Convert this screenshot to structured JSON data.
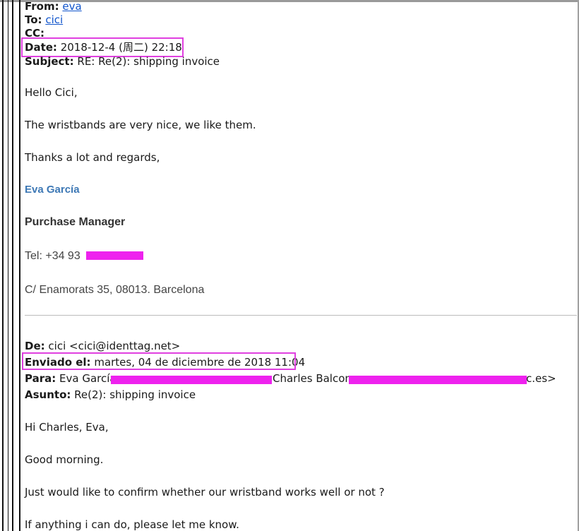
{
  "reply": {
    "from_label": "From:",
    "from_value": "eva",
    "to_label": "To:",
    "to_value": "cici",
    "cc_label": "CC:",
    "date_label": "Date:",
    "date_value": "2018-12-4 (周二) 22:18",
    "subject_label": "Subject:",
    "subject_value": "RE: Re(2): shipping invoice",
    "body": [
      "Hello Cici,",
      "The wristbands are very nice, we like them.",
      "Thanks a lot and regards,"
    ],
    "signature": {
      "name": "Eva García",
      "title": "Purchase Manager",
      "tel": "Tel: +34 93",
      "address": "C/ Enamorats 35, 08013. Barcelona"
    }
  },
  "original": {
    "de_label": "De:",
    "de_value": "cici <cici@identtag.net>",
    "enviado_label": "Enviado el:",
    "enviado_value": "martes, 04 de diciembre de 2018 11:04",
    "para_label": "Para:",
    "para_name1": "Eva García",
    "para_name2": "Charles Balcom",
    "para_tail": "c.es>",
    "asunto_label": "Asunto:",
    "asunto_value": "Re(2): shipping invoice",
    "body": [
      "Hi Charles, Eva,",
      "Good morning.",
      "Just would like to confirm whether our wristband works well or not ?",
      "If anything i can do, please let me know."
    ]
  },
  "colors": {
    "highlight": "#e040e0",
    "redaction": "#ee22ee",
    "link": "#1155cc",
    "signature_name": "#3d78b5"
  }
}
